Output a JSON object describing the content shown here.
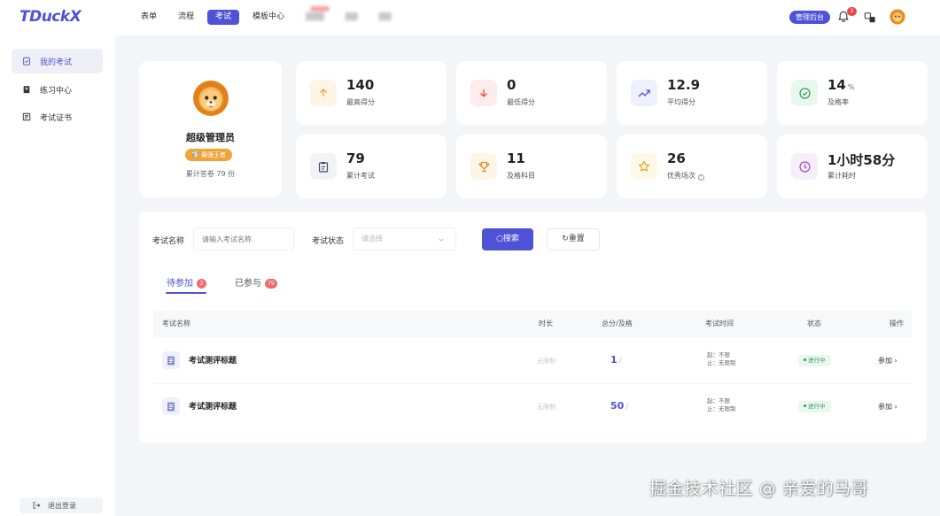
{
  "brand": {
    "logo": "TDuckX"
  },
  "nav": {
    "items": [
      {
        "label": "表单",
        "active": false,
        "blurred": false
      },
      {
        "label": "流程",
        "active": false,
        "blurred": false
      },
      {
        "label": "考试",
        "active": true,
        "blurred": false
      },
      {
        "label": "模板中心",
        "active": false,
        "blurred": false
      },
      {
        "label": "",
        "active": false,
        "blurred": true
      },
      {
        "label": "",
        "active": false,
        "blurred": true
      },
      {
        "label": "",
        "active": false,
        "blurred": true
      }
    ],
    "admin_label": "管理后台",
    "notification_count": "2"
  },
  "sidebar": {
    "items": [
      {
        "label": "我的考试",
        "icon": "clipboard-check-icon",
        "active": true
      },
      {
        "label": "练习中心",
        "icon": "notebook-icon",
        "active": false
      },
      {
        "label": "考试证书",
        "icon": "certificate-icon",
        "active": false
      }
    ],
    "logout_label": "退出登录"
  },
  "profile": {
    "name": "超级管理员",
    "rank_badge": "💎 最强王者",
    "answered_text": "累计答卷 79 份"
  },
  "stats": [
    {
      "value": "140",
      "unit": "",
      "label": "最高得分",
      "icon": "arrow-up-icon",
      "color": "#f0a33a",
      "bg": "#fff5e6"
    },
    {
      "value": "0",
      "unit": "",
      "label": "最低得分",
      "icon": "arrow-down-icon",
      "color": "#e5484d",
      "bg": "#fdeceb"
    },
    {
      "value": "12.9",
      "unit": "",
      "label": "平均得分",
      "icon": "trend-up-icon",
      "color": "#4e52d6",
      "bg": "#eef0fb"
    },
    {
      "value": "14",
      "unit": "%",
      "label": "及格率",
      "icon": "check-circle-icon",
      "color": "#2f9a57",
      "bg": "#e9f8ee"
    },
    {
      "value": "79",
      "unit": "",
      "label": "累计考试",
      "icon": "clipboard-icon",
      "color": "#3c4a66",
      "bg": "#f1f3f7"
    },
    {
      "value": "11",
      "unit": "",
      "label": "及格科目",
      "icon": "trophy-icon",
      "color": "#d98a2b",
      "bg": "#fff5e6"
    },
    {
      "value": "26",
      "unit": "",
      "label": "优秀场次",
      "icon": "star-icon",
      "color": "#e0a21d",
      "bg": "#fff8e6"
    },
    {
      "value": "1小时58分",
      "unit": "",
      "label": "累计耗时",
      "icon": "clock-icon",
      "color": "#a245c7",
      "bg": "#f7eefb"
    }
  ],
  "filters": {
    "name_label": "考试名称",
    "name_placeholder": "请输入考试名称",
    "status_label": "考试状态",
    "status_placeholder": "请选择",
    "search_label": "搜索",
    "reset_label": "重置"
  },
  "tabs": [
    {
      "label": "待参加",
      "badge": "2",
      "active": true
    },
    {
      "label": "已参与",
      "badge": "79",
      "active": false
    }
  ],
  "table": {
    "headers": [
      "考试名称",
      "时长",
      "总分/及格",
      "考试时间",
      "状态",
      "操作"
    ],
    "rows": [
      {
        "name": "考试测评标题",
        "duration": "无限制",
        "score": "1",
        "time_start": "起：不限",
        "time_end": "止：无限制",
        "status": "进行中",
        "action": "参加"
      },
      {
        "name": "考试测评标题",
        "duration": "无限制",
        "score": "50",
        "time_start": "起：不限",
        "time_end": "止：无限制",
        "status": "进行中",
        "action": "参加"
      }
    ]
  },
  "watermark": "掘金技术社区 @ 亲爱的马哥"
}
